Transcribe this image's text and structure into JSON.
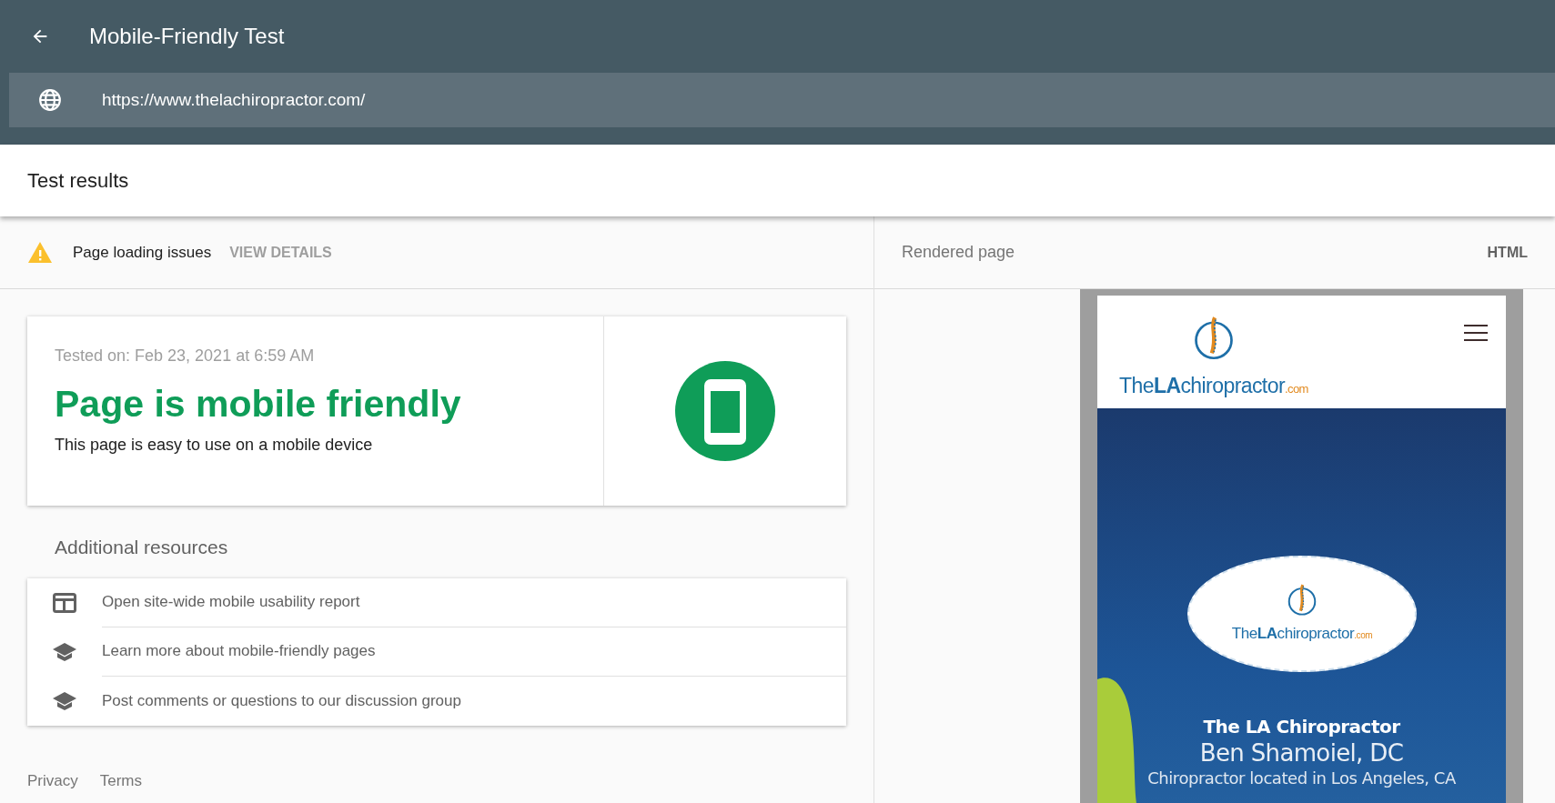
{
  "app_bar": {
    "title": "Mobile-Friendly Test",
    "url": "https://www.thelachiropractor.com/"
  },
  "results_header": {
    "title": "Test results"
  },
  "issues_bar": {
    "label": "Page loading issues",
    "action": "VIEW DETAILS"
  },
  "verdict_card": {
    "tested_on": "Tested on: Feb 23, 2021 at 6:59 AM",
    "headline": "Page is mobile friendly",
    "description": "This page is easy to use on a mobile device"
  },
  "additional_resources": {
    "title": "Additional resources",
    "items": [
      {
        "kind": "report",
        "label": "Open site-wide mobile usability report"
      },
      {
        "kind": "learn",
        "label": "Learn more about mobile-friendly pages"
      },
      {
        "kind": "learn",
        "label": "Post comments or questions to our discussion group"
      }
    ]
  },
  "footer": {
    "links": [
      "Privacy",
      "Terms"
    ]
  },
  "right_panel": {
    "tabs": [
      {
        "label": "Rendered page",
        "selected": true
      },
      {
        "label": "HTML",
        "selected": false
      }
    ]
  },
  "rendered_page": {
    "logo_name": "The**LA**chiropractor",
    "logo_tld": ".com",
    "badge_name": "The**LA**chiropractor",
    "badge_tld": ".com",
    "heading": "The LA Chiropractor",
    "name": "Ben Shamoiel, DC",
    "tagline": "Chiropractor located in Los Angeles, CA"
  }
}
